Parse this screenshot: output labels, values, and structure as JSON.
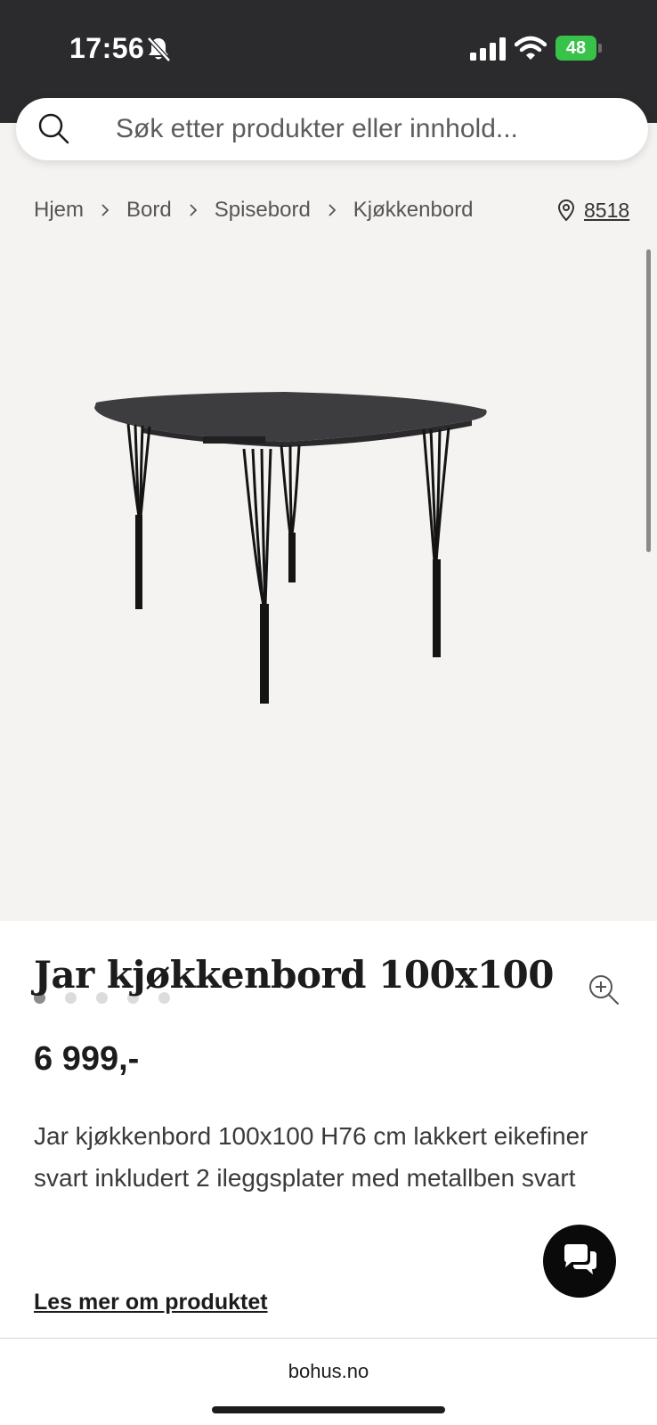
{
  "status_bar": {
    "time": "17:56",
    "battery": "48",
    "icons": [
      "bell-slash-icon",
      "signal-icon",
      "wifi-icon",
      "battery-charging-icon"
    ]
  },
  "search": {
    "placeholder": "Søk etter produkter eller innhold..."
  },
  "breadcrumb": [
    "Hjem",
    "Bord",
    "Spisebord",
    "Kjøkkenbord"
  ],
  "store": {
    "code": "8518"
  },
  "gallery": {
    "image_count": 5,
    "active_index": 0
  },
  "product": {
    "title": "Jar kjøkkenbord 100x100",
    "price": "6 999,-",
    "description": "Jar kjøkkenbord 100x100 H76 cm lakkert eikefiner svart inkludert 2 ileggsplater med metallben svart",
    "read_more": "Les mer om produktet"
  },
  "browser": {
    "url": "bohus.no"
  },
  "colors": {
    "status_bar_bg": "#2b2b2e",
    "page_bg": "#f4f3f1",
    "battery_green": "#37c24a",
    "text": "#1c1c1c"
  }
}
